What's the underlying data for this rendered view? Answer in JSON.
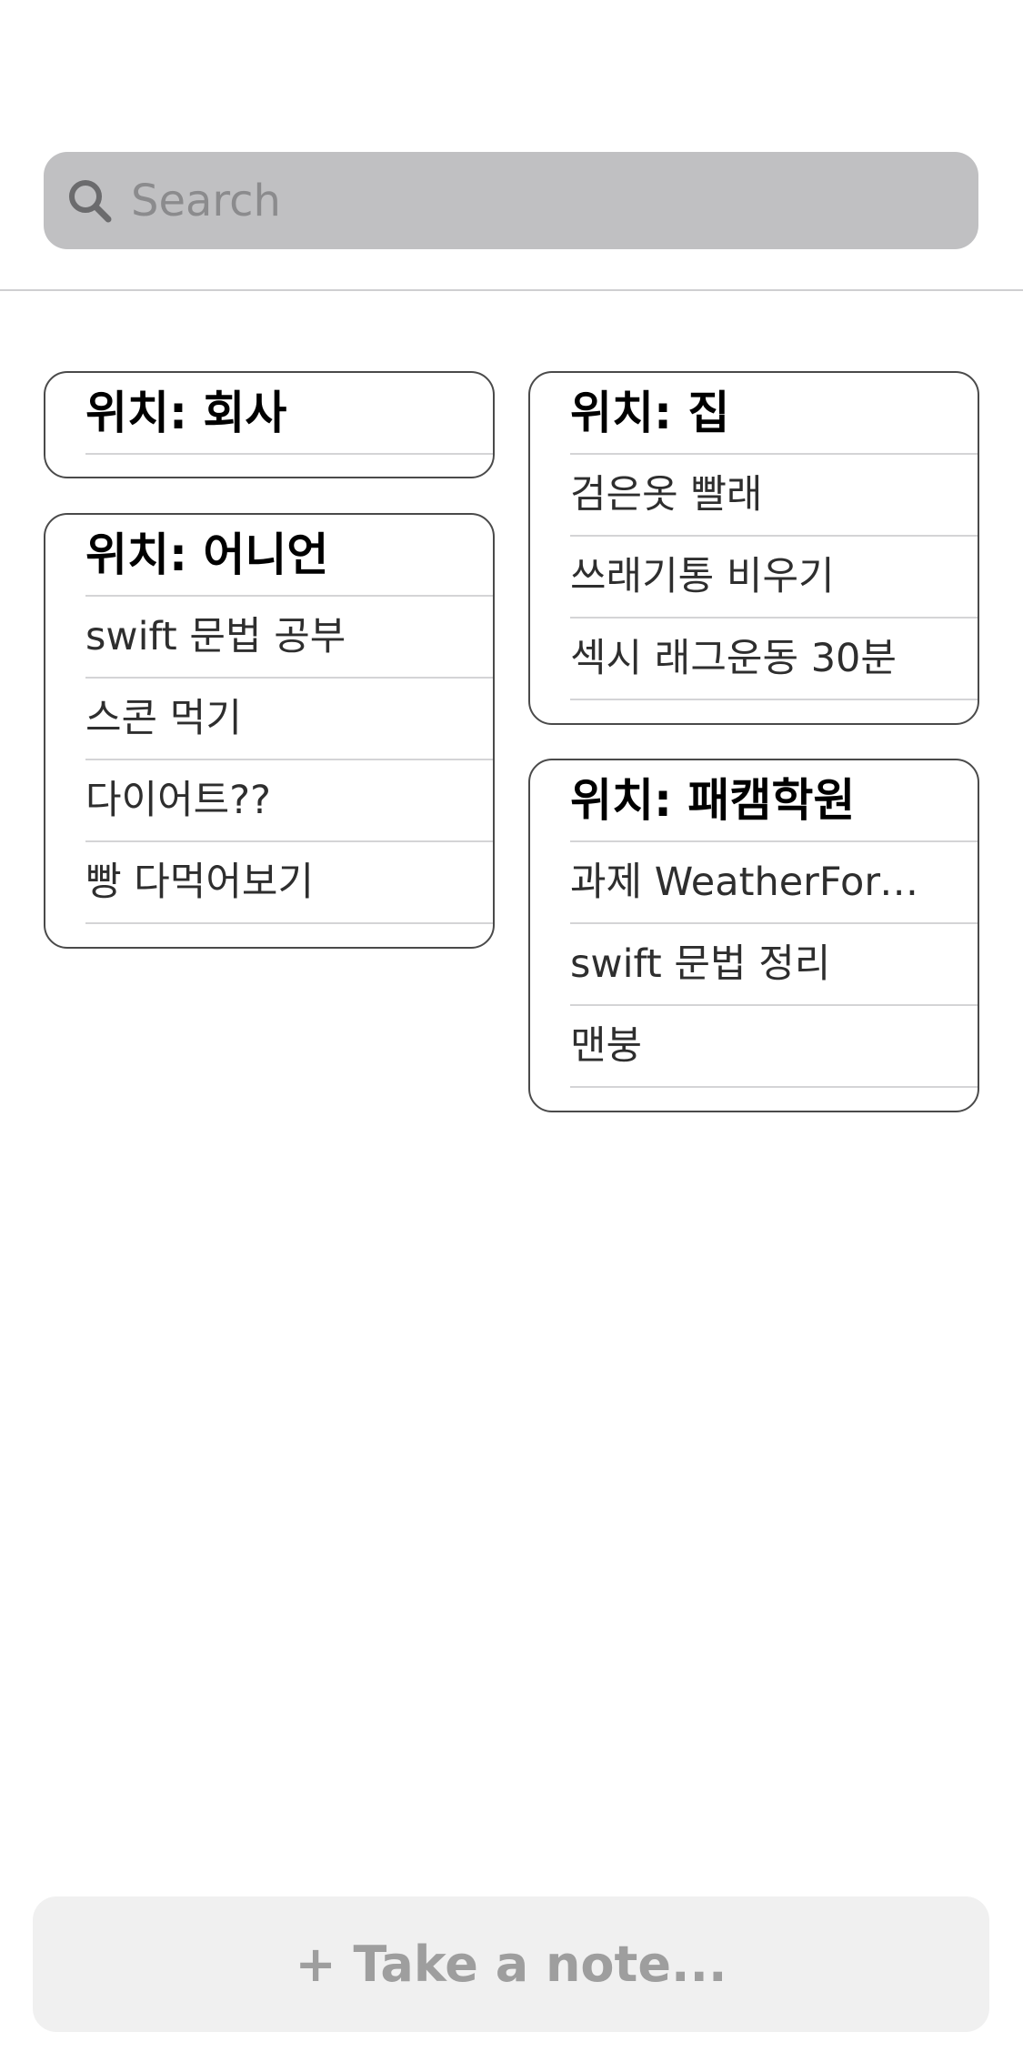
{
  "search": {
    "placeholder": "Search"
  },
  "cards": {
    "company": {
      "title": "위치: 회사",
      "items": []
    },
    "onion": {
      "title": "위치: 어니언",
      "items": [
        "swift 문법 공부",
        "스콘 먹기",
        "다이어트??",
        "빵 다먹어보기"
      ]
    },
    "home": {
      "title": "위치: 집",
      "items": [
        "검은옷 빨래",
        "쓰래기통 비우기",
        "섹시 래그운동 30분"
      ]
    },
    "fastcampus": {
      "title": "위치: 패캠학원",
      "items": [
        "과제 WeatherFore...",
        "swift 문법 정리",
        "맨붕"
      ]
    }
  },
  "note": {
    "label": "+ Take a note..."
  },
  "icons": {
    "search": "search-icon"
  }
}
